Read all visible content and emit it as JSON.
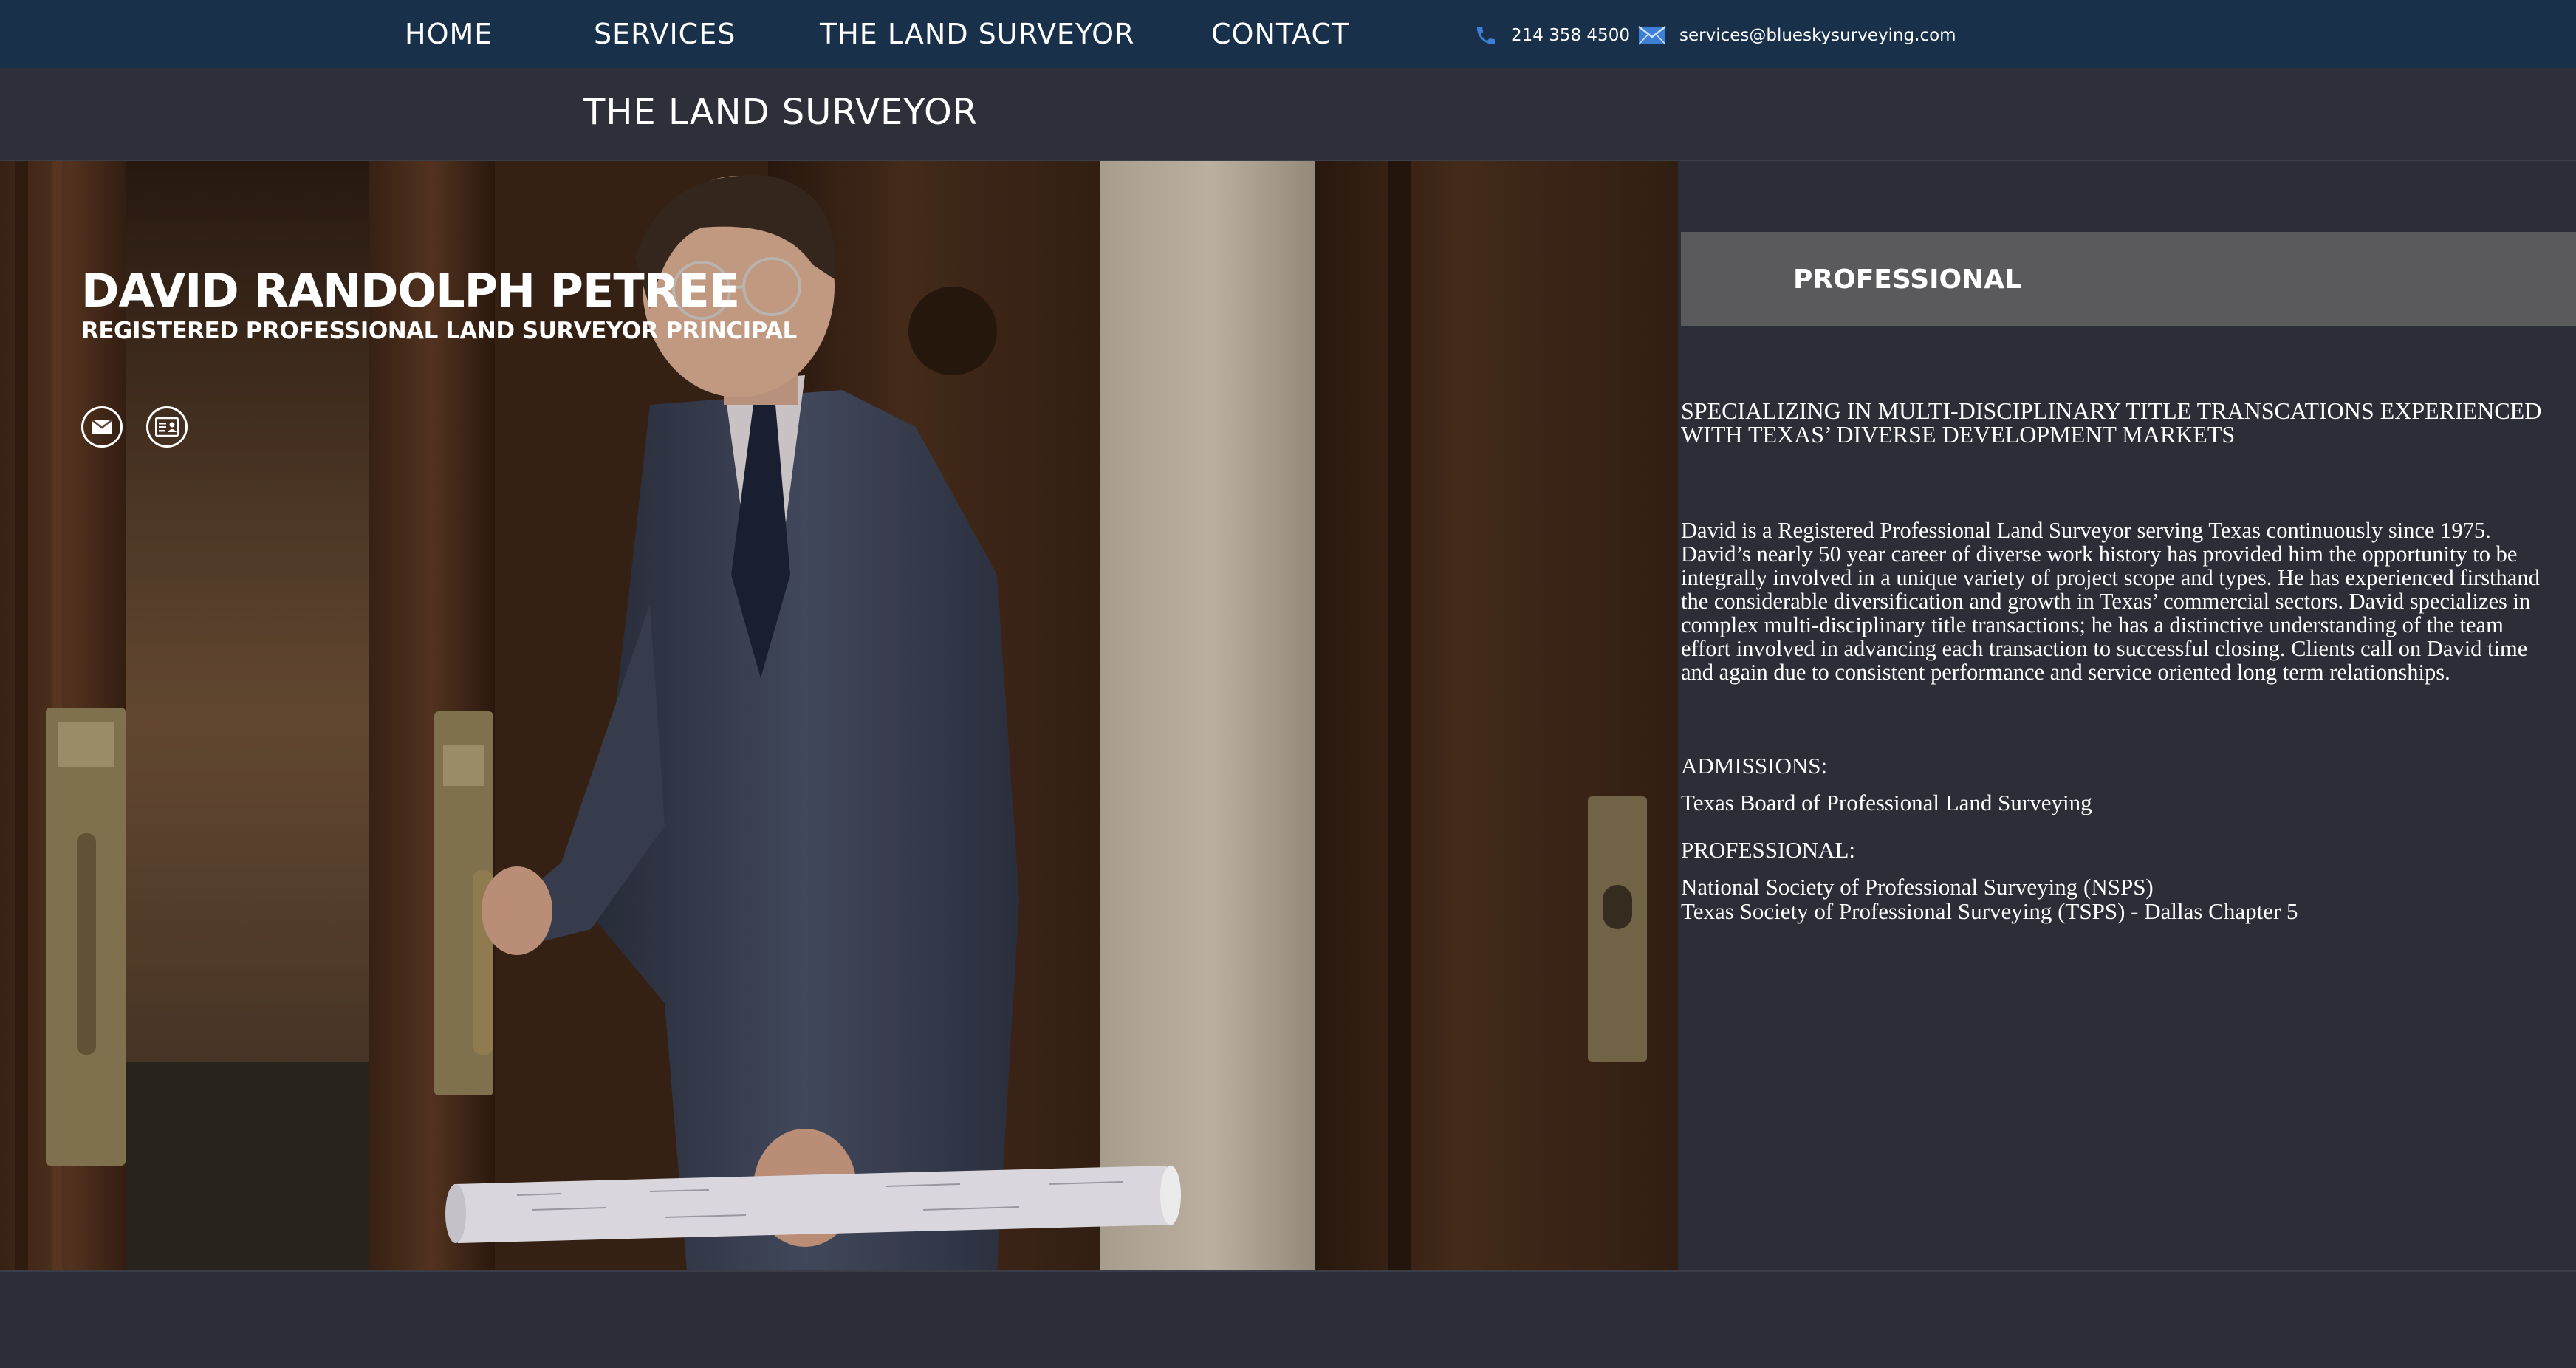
{
  "nav": {
    "items": [
      "HOME",
      "SERVICES",
      "THE LAND SURVEYOR",
      "CONTACT"
    ],
    "phone": "214 358 4500",
    "email": "services@blueskysurveying.com",
    "phone_icon": "phone-icon",
    "email_icon": "envelope-icon"
  },
  "page": {
    "title": "THE LAND SURVEYOR"
  },
  "profile": {
    "name": "DAVID RANDOLPH PETREE",
    "role": "REGISTERED PROFESSIONAL LAND SURVEYOR PRINCIPAL",
    "icons": [
      "mail-icon",
      "vcard-icon"
    ]
  },
  "section": {
    "title": "PROFESSIONAL",
    "tagline": [
      "SPECIALIZING IN MULTI-DISCIPLINARY TITLE TRANSCATIONS EXPERIENCED",
      "WITH TEXAS’ DIVERSE DEVELOPMENT MARKETS"
    ],
    "bio": [
      "David is a Registered Professional Land Surveyor serving Texas continuously since 1975.",
      "David’s nearly 50 year career of diverse work history has provided him the opportunity to be",
      "integrally involved in a unique variety of project scope and types. He has experienced firsthand",
      "the considerable diversification and growth in Texas’ commercial sectors. David specializes in",
      "complex multi-disciplinary title transactions; he has a distinctive understanding of the team",
      "effort involved in advancing each transaction to successful closing. Clients call on David time",
      "and again due to consistent performance and service oriented long term relationships."
    ],
    "admissions_label": "ADMISSIONS:",
    "admissions": [
      "Texas Board of Professional Land Surveying"
    ],
    "professional_label": "PROFESSIONAL:",
    "professional": [
      "National Society of Professional Surveying (NSPS)",
      "Texas Society of Professional Surveying (TSPS) - Dallas Chapter 5"
    ]
  },
  "colors": {
    "nav_bg": "#18304a",
    "page_bg": "#2b2e37",
    "section_bar": "#5a5a5c",
    "icon_accent": "#3d7fd6"
  }
}
